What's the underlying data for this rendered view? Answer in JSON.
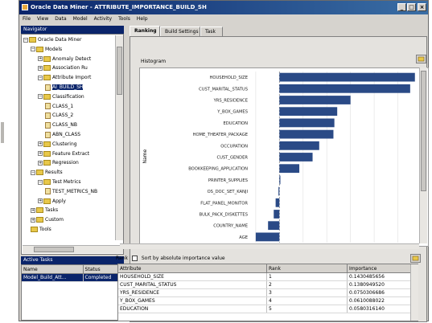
{
  "window": {
    "title": "Oracle Data Miner - ATTRIBUTE_IMPORTANCE_BUILD_SH",
    "minimize": "_",
    "maximize": "□",
    "close": "×"
  },
  "menu": [
    "File",
    "View",
    "Data",
    "Model",
    "Activity",
    "Tools",
    "Help"
  ],
  "navigator": {
    "title": "Navigator",
    "rows": [
      {
        "label": "Oracle Data Miner",
        "level": 0,
        "expander": "−",
        "kind": "folder",
        "selected": false
      },
      {
        "label": "Models",
        "level": 1,
        "expander": "−",
        "kind": "folder",
        "selected": false
      },
      {
        "label": "Anomaly Detect",
        "level": 2,
        "expander": "+",
        "kind": "folder",
        "selected": false
      },
      {
        "label": "Association Ru",
        "level": 2,
        "expander": "+",
        "kind": "folder",
        "selected": false
      },
      {
        "label": "Attribute Import",
        "level": 2,
        "expander": "−",
        "kind": "folder",
        "selected": false
      },
      {
        "label": "AI_BUILD_SH",
        "level": 3,
        "expander": "",
        "kind": "doc",
        "selected": true
      },
      {
        "label": "Classification",
        "level": 2,
        "expander": "−",
        "kind": "folder",
        "selected": false
      },
      {
        "label": "CLASS_1",
        "level": 3,
        "expander": "",
        "kind": "doc",
        "selected": false
      },
      {
        "label": "CLASS_2",
        "level": 3,
        "expander": "",
        "kind": "doc",
        "selected": false
      },
      {
        "label": "CLASS_NB",
        "level": 3,
        "expander": "",
        "kind": "doc",
        "selected": false
      },
      {
        "label": "ABN_CLASS",
        "level": 3,
        "expander": "",
        "kind": "doc",
        "selected": false
      },
      {
        "label": "Clustering",
        "level": 2,
        "expander": "+",
        "kind": "folder",
        "selected": false
      },
      {
        "label": "Feature Extract",
        "level": 2,
        "expander": "+",
        "kind": "folder",
        "selected": false
      },
      {
        "label": "Regression",
        "level": 2,
        "expander": "+",
        "kind": "folder",
        "selected": false
      },
      {
        "label": "Results",
        "level": 1,
        "expander": "−",
        "kind": "folder",
        "selected": false
      },
      {
        "label": "Test Metrics",
        "level": 2,
        "expander": "−",
        "kind": "folder",
        "selected": false
      },
      {
        "label": "TEST_METRICS_NB",
        "level": 3,
        "expander": "",
        "kind": "doc",
        "selected": false
      },
      {
        "label": "Apply",
        "level": 2,
        "expander": "+",
        "kind": "folder",
        "selected": false
      },
      {
        "label": "Tasks",
        "level": 1,
        "expander": "+",
        "kind": "folder",
        "selected": false
      },
      {
        "label": "Custom",
        "level": 1,
        "expander": "+",
        "kind": "folder",
        "selected": false
      },
      {
        "label": "Tools",
        "level": 1,
        "expander": "",
        "kind": "folder",
        "selected": false
      }
    ]
  },
  "active_tasks": {
    "title": "Active Tasks",
    "columns": [
      "Name",
      "Status"
    ],
    "rows": [
      [
        "Model_Build_Att...",
        "Completed"
      ]
    ]
  },
  "tabs": [
    {
      "label": "Ranking",
      "active": true
    },
    {
      "label": "Build Settings",
      "active": false
    },
    {
      "label": "Task",
      "active": false
    }
  ],
  "histogram_label": "Histogram",
  "chart_data": {
    "type": "bar",
    "orientation": "horizontal",
    "ylabel": "Name",
    "categories": [
      "HOUSEHOLD_SIZE",
      "CUST_MARITAL_STATUS",
      "YRS_RESIDENCE",
      "Y_BOX_GAMES",
      "EDUCATION",
      "HOME_THEATER_PACKAGE",
      "OCCUPATION",
      "CUST_GENDER",
      "BOOKKEEPING_APPLICATION",
      "PRINTER_SUPPLIES",
      "OS_DOC_SET_KANJI",
      "FLAT_PANEL_MONITOR",
      "BULK_PACK_DISKETTES",
      "COUNTRY_NAME",
      "AGE"
    ],
    "values": [
      0.143,
      0.138,
      0.075,
      0.061,
      0.058,
      0.057,
      0.042,
      0.035,
      0.021,
      0.001,
      -0.001,
      -0.004,
      -0.006,
      -0.012,
      -0.025
    ],
    "xlim": [
      -0.03,
      0.15
    ],
    "grid": true,
    "bar_color": "#2a4a86",
    "legend": "none"
  },
  "ranking_header": {
    "label": "Rank",
    "checkbox_label": "Sort by absolute importance value",
    "checked": false
  },
  "table": {
    "columns": [
      "Attribute",
      "Rank",
      "Importance"
    ],
    "rows": [
      [
        "HOUSEHOLD_SIZE",
        "1",
        "0.1430485656"
      ],
      [
        "CUST_MARITAL_STATUS",
        "2",
        "0.1380949520"
      ],
      [
        "YRS_RESIDENCE",
        "3",
        "0.0750306686"
      ],
      [
        "Y_BOX_GAMES",
        "4",
        "0.0610088022"
      ],
      [
        "EDUCATION",
        "5",
        "0.0580316140"
      ]
    ]
  },
  "colors": {
    "title_bar": "#0a246a",
    "chrome": "#d6d3ce",
    "bar": "#2a4a86"
  }
}
